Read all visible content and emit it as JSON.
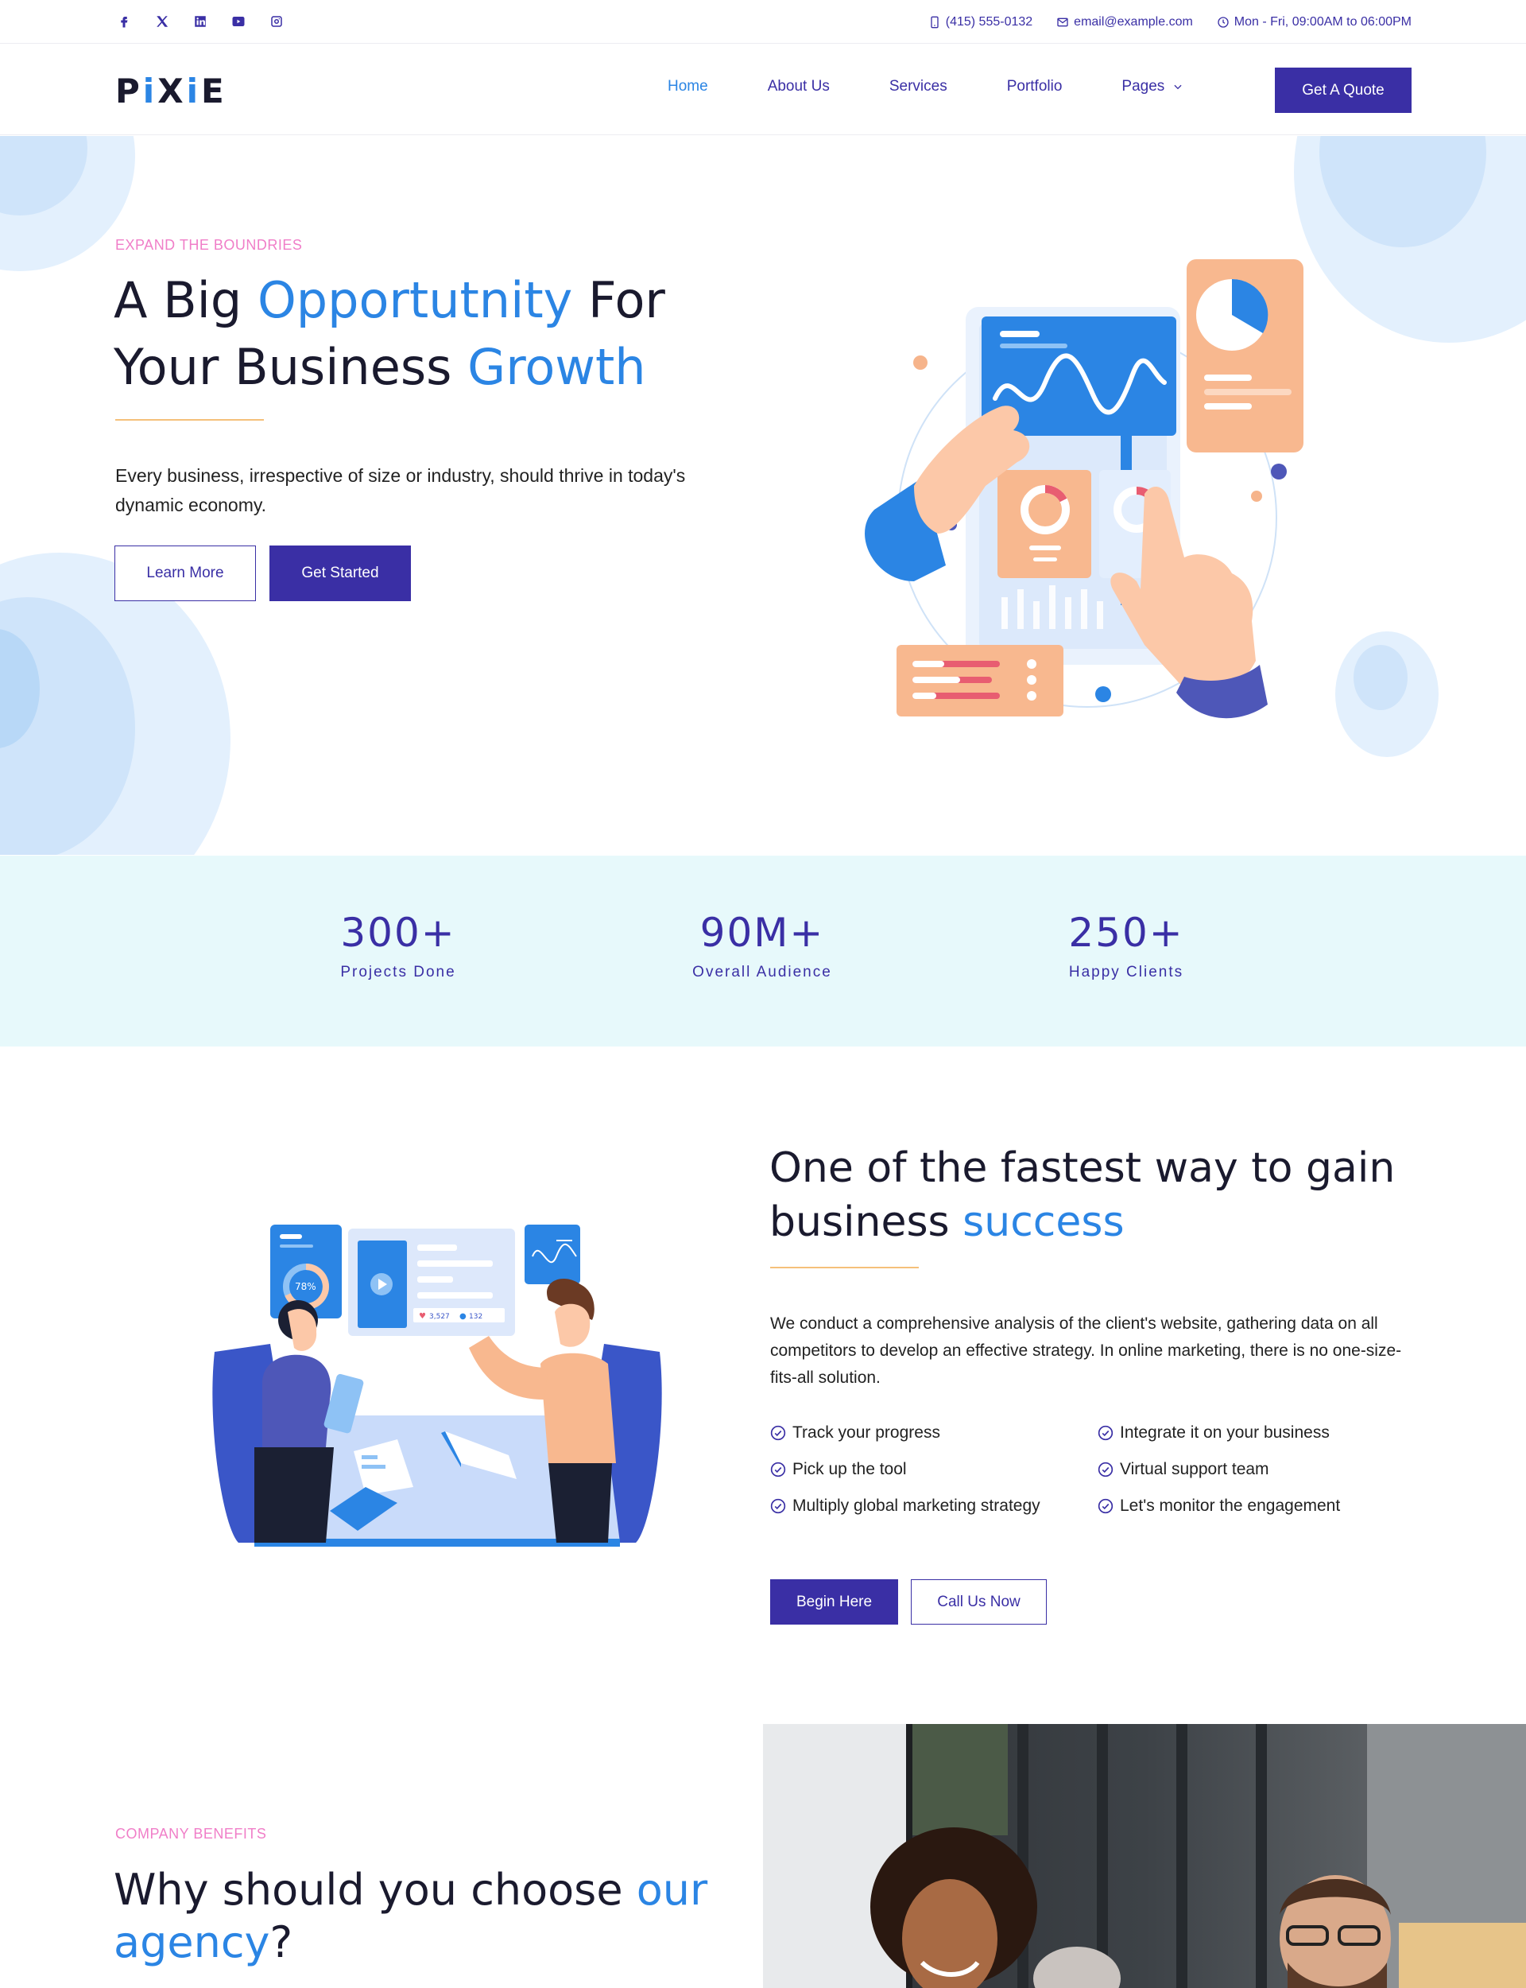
{
  "topbar": {
    "social": [
      "facebook-icon",
      "x-icon",
      "linkedin-icon",
      "youtube-icon",
      "instagram-icon"
    ],
    "phone": "(415) 555-0132",
    "email": "email@example.com",
    "hours": "Mon - Fri, 09:00AM to 06:00PM"
  },
  "nav": {
    "logo_parts": [
      "P",
      "i",
      "X",
      "i",
      "E"
    ],
    "items": [
      {
        "label": "Home",
        "active": true
      },
      {
        "label": "About Us"
      },
      {
        "label": "Services"
      },
      {
        "label": "Portfolio"
      },
      {
        "label": "Pages",
        "has_dropdown": true
      }
    ],
    "cta": "Get A Quote"
  },
  "hero": {
    "eyebrow": "EXPAND THE BOUNDRIES",
    "title_1": "A Big ",
    "title_2": "Opportutnity",
    "title_3": " For Your Business ",
    "title_4": "Growth",
    "description": "Every business, irrespective of size or industry, should thrive in today's dynamic economy.",
    "btn_learn": "Learn More",
    "btn_start": "Get Started"
  },
  "stats": [
    {
      "value": "300+",
      "label": "Projects Done"
    },
    {
      "value": "90M+",
      "label": "Overall Audience"
    },
    {
      "value": "250+",
      "label": "Happy Clients"
    }
  ],
  "fast": {
    "title_1": "One of the fastest way to gain business ",
    "title_2": "success",
    "description": "We conduct a comprehensive analysis of the client's website, gathering data on all competitors to develop an effective strategy. In online marketing, there is no one-size-fits-all solution.",
    "checks": [
      "Track your progress",
      "Integrate it on your business",
      "Pick up the tool",
      "Virtual support team",
      "Multiply global marketing strategy",
      "Let's monitor the engagement"
    ],
    "btn_begin": "Begin Here",
    "btn_call": "Call Us Now",
    "illus_percent": "78%",
    "illus_likes": "3,527",
    "illus_comments": "132"
  },
  "benefits": {
    "eyebrow": "COMPANY BENEFITS",
    "title_1": "Why should you choose ",
    "title_2": "our agency",
    "title_3": "?"
  },
  "colors": {
    "primary": "#3a2fa5",
    "accent_blue": "#2b85e4",
    "eyebrow_pink": "#f07ec8",
    "rule_gold": "#f5c07a",
    "stats_bg": "#e7f9fb"
  }
}
